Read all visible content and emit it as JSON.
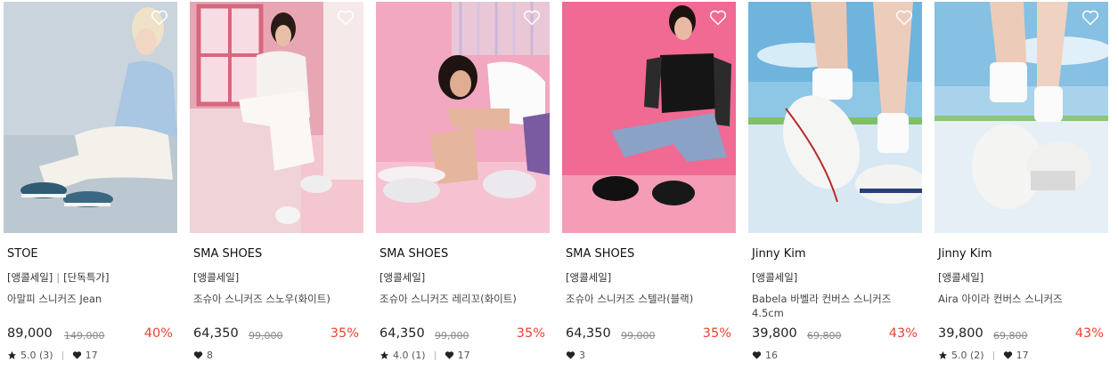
{
  "products": [
    {
      "brand": "STOE",
      "tags": [
        "[앵콜세일]",
        "[단독특가]"
      ],
      "name": "아말피 스니커즈 Jean",
      "price": "89,000",
      "original_price": "149,000",
      "discount": "40%",
      "rating": "5.0 (3)",
      "likes": "17"
    },
    {
      "brand": "SMA SHOES",
      "tags": [
        "[앵콜세일]"
      ],
      "name": "조슈아 스니커즈 스노우(화이트)",
      "price": "64,350",
      "original_price": "99,000",
      "discount": "35%",
      "rating": "",
      "likes": "8"
    },
    {
      "brand": "SMA SHOES",
      "tags": [
        "[앵콜세일]"
      ],
      "name": "조슈아 스니커즈 레리꼬(화이트)",
      "price": "64,350",
      "original_price": "99,000",
      "discount": "35%",
      "rating": "4.0 (1)",
      "likes": "17"
    },
    {
      "brand": "SMA SHOES",
      "tags": [
        "[앵콜세일]"
      ],
      "name": "조슈아 스니커즈 스텔라(블랙)",
      "price": "64,350",
      "original_price": "99,000",
      "discount": "35%",
      "rating": "",
      "likes": "3"
    },
    {
      "brand": "Jinny Kim",
      "tags": [
        "[앵콜세일]"
      ],
      "name": "Babela 바벨라 컨버스 스니커즈 4.5cm",
      "price": "39,800",
      "original_price": "69,800",
      "discount": "43%",
      "rating": "",
      "likes": "16"
    },
    {
      "brand": "Jinny Kim",
      "tags": [
        "[앵콜세일]"
      ],
      "name": "Aira 아이라 컨버스 스니커즈",
      "price": "39,800",
      "original_price": "69,800",
      "discount": "43%",
      "rating": "5.0 (2)",
      "likes": "17"
    }
  ],
  "icons": {
    "wishlist": "heart-outline-icon",
    "rating": "star-icon",
    "likes": "heart-filled-icon"
  },
  "colors": {
    "discount": "#e8432f",
    "text": "#222222",
    "muted": "#888888"
  }
}
